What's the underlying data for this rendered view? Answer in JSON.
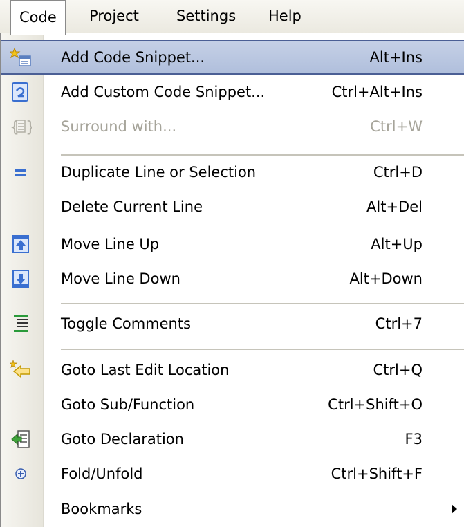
{
  "menubar": {
    "items": [
      {
        "label": "Code"
      },
      {
        "label": "Project"
      },
      {
        "label": "Settings"
      },
      {
        "label": "Help"
      }
    ]
  },
  "menu": {
    "items": [
      {
        "label": "Add Code Snippet...",
        "shortcut": "Alt+Ins",
        "icon": "add-code-snippet-icon",
        "highlighted": true
      },
      {
        "label": "Add Custom Code Snippet...",
        "shortcut": "Ctrl+Alt+Ins",
        "icon": "add-custom-snippet-icon"
      },
      {
        "label": "Surround with...",
        "shortcut": "Ctrl+W",
        "icon": "surround-with-icon",
        "disabled": true
      },
      {
        "label": "Duplicate Line or Selection",
        "shortcut": "Ctrl+D",
        "icon": "duplicate-line-icon"
      },
      {
        "label": "Delete Current Line",
        "shortcut": "Alt+Del"
      },
      {
        "label": "Move Line Up",
        "shortcut": "Alt+Up",
        "icon": "arrow-up-icon"
      },
      {
        "label": "Move Line Down",
        "shortcut": "Alt+Down",
        "icon": "arrow-down-icon"
      },
      {
        "label": "Toggle Comments",
        "shortcut": "Ctrl+7",
        "icon": "toggle-comments-icon"
      },
      {
        "label": "Goto Last Edit Location",
        "shortcut": "Ctrl+Q",
        "icon": "back-arrow-icon"
      },
      {
        "label": "Goto Sub/Function",
        "shortcut": "Ctrl+Shift+O"
      },
      {
        "label": "Goto Declaration",
        "shortcut": "F3",
        "icon": "goto-declaration-icon"
      },
      {
        "label": "Fold/Unfold",
        "shortcut": "Ctrl+Shift+F",
        "icon": "fold-plus-icon"
      },
      {
        "label": "Bookmarks",
        "shortcut": "",
        "submenu": true
      }
    ]
  },
  "colors": {
    "highlight": "#b0bfdc",
    "highlight_border": "#4b5f95",
    "disabled_text": "#a6a49a",
    "icon_blue": "#3a6fd0"
  }
}
